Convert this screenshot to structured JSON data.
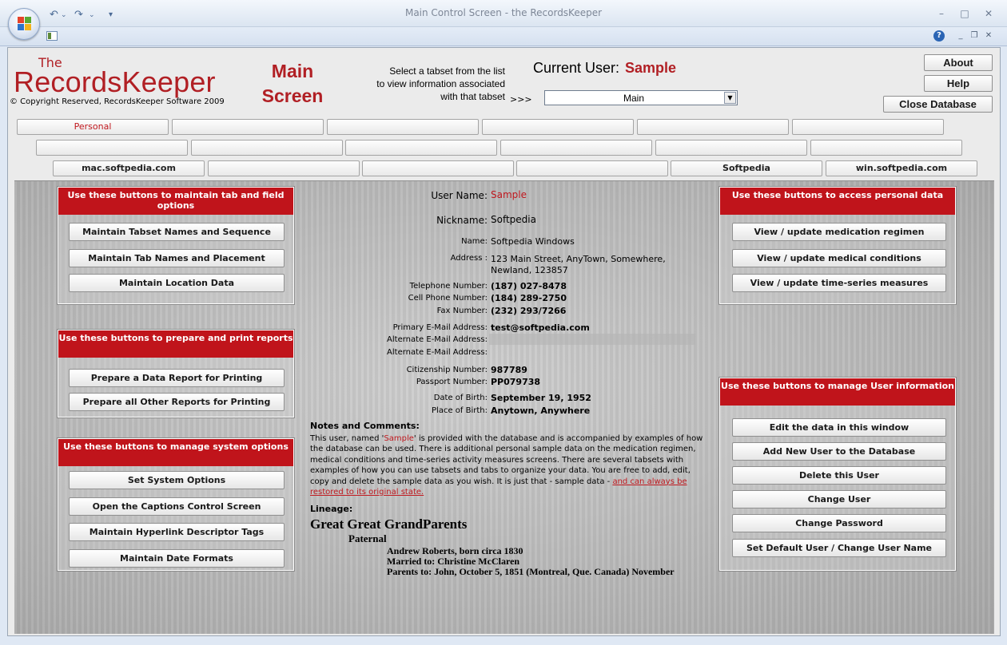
{
  "window": {
    "title": "Main Control Screen  -  the RecordsKeeper",
    "minimize": "–",
    "maximize": "□",
    "close": "✕",
    "help": "?",
    "sub_min": "_",
    "sub_restore": "❐",
    "sub_close": "✕",
    "undo": "↶",
    "redo": "↷",
    "qat_more": "▾"
  },
  "header": {
    "the": "The",
    "app_name": "RecordsKeeper",
    "copyright": "© Copyright Reserved, RecordsKeeper Software  2009",
    "main_title_1": "Main",
    "main_title_2": "Screen",
    "instruction_1": "Select a tabset from the list",
    "instruction_2": "to view information associated",
    "instruction_3": "with that tabset",
    "arrows": ">>>",
    "current_user_label": "Current User:",
    "current_user_value": "Sample",
    "tabset_selected": "Main",
    "about": "About",
    "help": "Help",
    "close_db": "Close Database"
  },
  "tabs": {
    "row1": [
      "Personal",
      "",
      "",
      "",
      "",
      ""
    ],
    "row2": [
      "",
      "",
      "",
      "",
      "",
      ""
    ],
    "row3": [
      "mac.softpedia.com",
      "",
      "",
      "",
      "Softpedia",
      "win.softpedia.com"
    ]
  },
  "left": {
    "tab_panel_title": "Use these buttons to maintain tab and field options",
    "tab_buttons": [
      "Maintain Tabset Names and Sequence",
      "Maintain Tab Names and Placement",
      "Maintain Location Data"
    ],
    "report_panel_title": "Use these buttons to prepare and print reports",
    "report_buttons": [
      "Prepare a Data Report for Printing",
      "Prepare all Other Reports for Printing"
    ],
    "system_panel_title": "Use these buttons to manage system options",
    "system_buttons": [
      "Set System Options",
      "Open the Captions Control Screen",
      "Maintain Hyperlink Descriptor Tags",
      "Maintain Date Formats"
    ]
  },
  "right": {
    "personal_panel_title": "Use these buttons to access personal data",
    "personal_buttons": [
      "View / update medication regimen",
      "View / update medical conditions",
      "View / update time-series measures"
    ],
    "user_panel_title": "Use these buttons to manage User information",
    "user_buttons": [
      "Edit the data in this window",
      "Add New User to the Database",
      "Delete this User",
      "Change User",
      "Change Password",
      "Set Default User / Change User Name"
    ]
  },
  "user": {
    "username_label": "User Name:",
    "username": "Sample",
    "nickname_label": "Nickname:",
    "nickname": "Softpedia",
    "name_label": "Name:",
    "name": "Softpedia  Windows",
    "address_label": "Address :",
    "address_1": "123 Main Street, AnyTown, Somewhere,",
    "address_2": "Newland, 123857",
    "tel_label": "Telephone Number:",
    "tel": "(187) 027-8478",
    "cell_label": "Cell Phone Number:",
    "cell": "(184) 289-2750",
    "fax_label": "Fax Number:",
    "fax": "(232) 293/7266",
    "email1_label": "Primary E-Mail Address:",
    "email1": "test@softpedia.com",
    "email2_label": "Alternate E-Mail Address:",
    "email3_label": "Alternate E-Mail Address:",
    "citizenship_label": "Citizenship Number:",
    "citizenship": "987789",
    "passport_label": "Passport Number:",
    "passport": "PP079738",
    "dob_label": "Date of Birth:",
    "dob": "September 19, 1952",
    "pob_label": "Place of Birth:",
    "pob": "Anytown, Anywhere"
  },
  "notes": {
    "heading": "Notes and Comments:",
    "text_a": "This user, named '",
    "text_name": "Sample",
    "text_b": "' is provided with the database and is accompanied by examples of how the database can be used. There is additional personal sample data on the medication regimen, medical conditions and time-series activity measures screens. There are several tabsets with examples of how you can use tabsets and tabs to organize your data. You are free to add, edit, copy and delete the sample data as you wish. It is just that - sample data - ",
    "link": "and can always be restored to its original state."
  },
  "lineage": {
    "heading": "Lineage:",
    "title": "Great Great GrandParents",
    "side": "Paternal",
    "line1": "Andrew Roberts, born circa 1830",
    "line2": "Married to: Christine McClaren",
    "line3": "Parents to: John, October 5, 1851 (Montreal, Que. Canada) November"
  },
  "colors": {
    "accent_red": "#c0141b",
    "window_bg": "#dfe8f4",
    "content_gray": "#b7b7b7"
  }
}
